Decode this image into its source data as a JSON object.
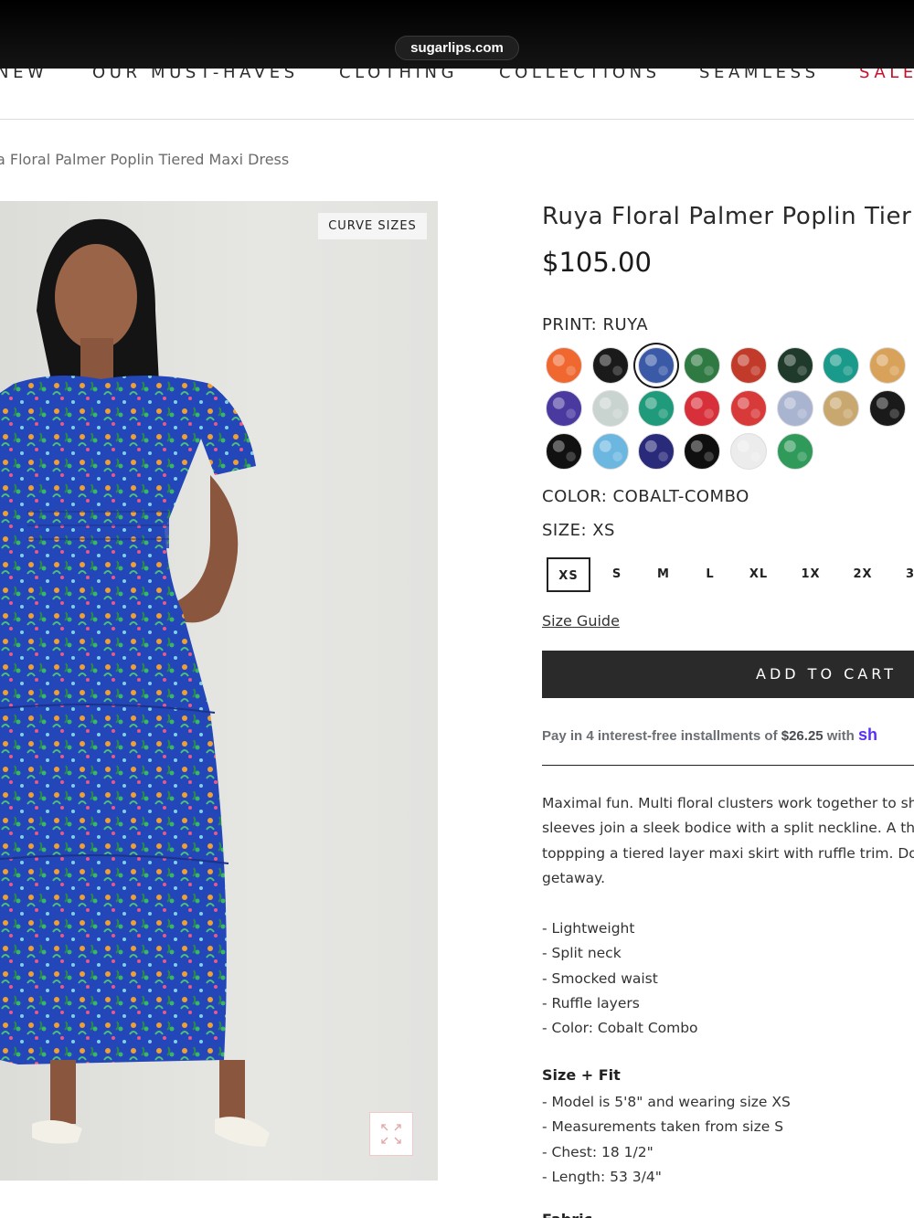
{
  "browser": {
    "url": "sugarlips.com"
  },
  "nav": {
    "items": [
      "NEW",
      "OUR MUST-HAVES",
      "CLOTHING",
      "COLLECTIONS",
      "SEAMLESS",
      "SALE"
    ]
  },
  "breadcrumb": "a Floral Palmer Poplin Tiered Maxi Dress",
  "image": {
    "badge": "CURVE SIZES",
    "expand_icon": "expand-icon"
  },
  "product": {
    "title": "Ruya Floral Palmer Poplin Tier",
    "price": "$105.00",
    "print_label": "PRINT: RUYA",
    "color_label": "COLOR: COBALT-COMBO",
    "size_label": "SIZE: XS",
    "sizes": [
      "XS",
      "S",
      "M",
      "L",
      "XL",
      "1X",
      "2X",
      "3"
    ],
    "selected_size": "XS",
    "size_guide": "Size Guide",
    "add_to_cart": "ADD TO CART",
    "shoppay": {
      "prefix": "Pay in 4 interest-free installments of ",
      "amount": "$26.25",
      "mid": " with ",
      "brand": "sh"
    },
    "swatches": [
      "#f0682f",
      "#1a1a1a",
      "#3a5aa8",
      "#2f7a42",
      "#c23a2a",
      "#1f3a2a",
      "#1a9a8a",
      "#d9a25a",
      "#4a3aa0",
      "#c9d4d0",
      "#1f9a7a",
      "#d8303a",
      "#d83a3a",
      "#a9b4d0",
      "#c9a870",
      "#1a1a1a",
      "#111111",
      "#6bb7e0",
      "#2a2a7a",
      "#0f0f0f",
      "#ececec",
      "#2f9a5a"
    ],
    "selected_swatch": 2
  },
  "description": {
    "lines": [
      "Maximal fun. Multi floral clusters work together to sh",
      "sleeves join a sleek bodice with a split neckline. A thi",
      "toppping a tiered layer maxi skirt with ruffle trim. Do",
      "getaway."
    ],
    "bullets": [
      "- Lightweight",
      "- Split neck",
      "- Smocked waist",
      "- Ruffle layers",
      "- Color: Cobalt Combo"
    ]
  },
  "size_fit": {
    "title": "Size + Fit",
    "items": [
      "- Model is 5'8\" and wearing size XS",
      "- Measurements taken from size S",
      "- Chest: 18 1/2\"",
      "- Length: 53 3/4\""
    ]
  },
  "fabric_title": "Fabric"
}
